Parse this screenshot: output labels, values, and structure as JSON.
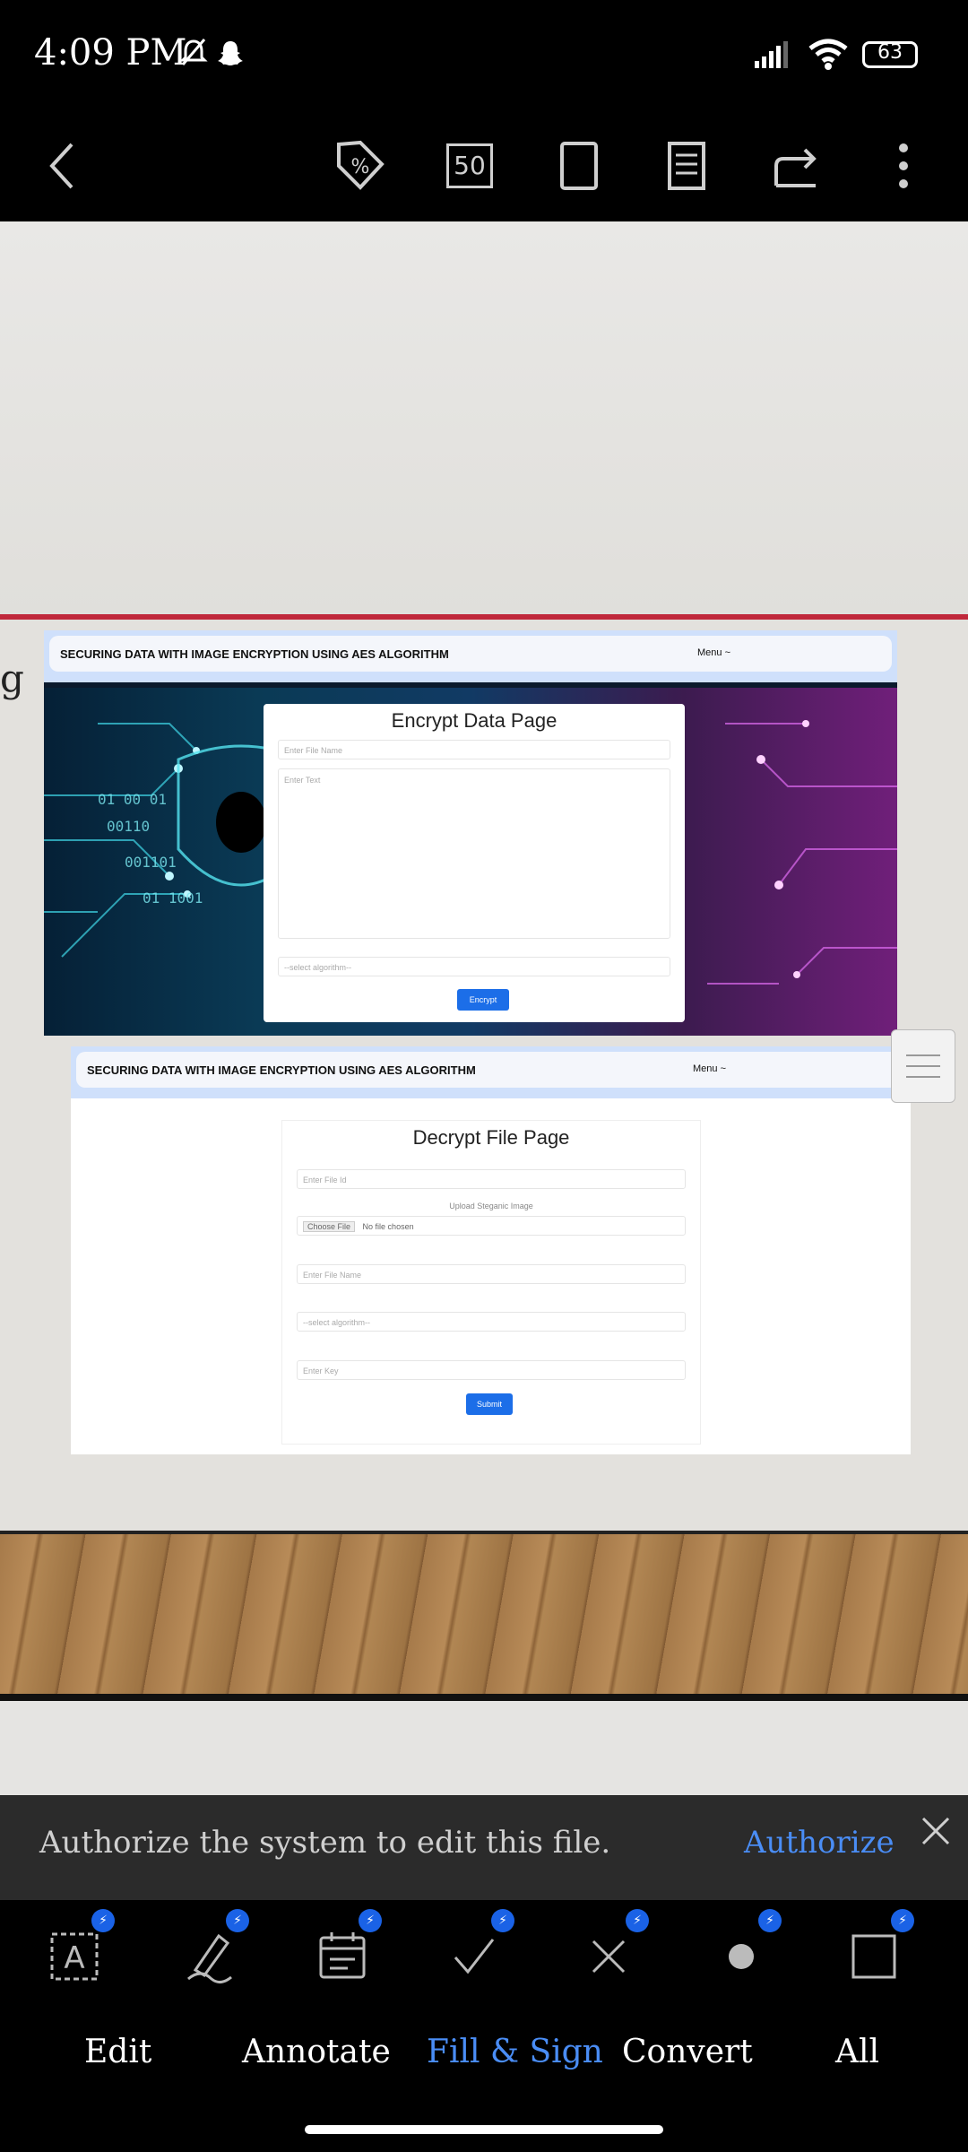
{
  "status_bar": {
    "time": "4:09 PM",
    "battery": "63"
  },
  "toolbar": {
    "page_box": "50"
  },
  "document": {
    "left_fragment": "g",
    "encrypt_page": {
      "nav_title": "SECURING DATA WITH IMAGE ENCRYPTION USING AES ALGORITHM",
      "nav_menu": "Menu ~",
      "title": "Encrypt Data Page",
      "file_name_placeholder": "Enter File Name",
      "text_placeholder": "Enter Text",
      "algorithm_select": "--select algorithm--",
      "button": "Encrypt"
    },
    "decrypt_page": {
      "nav_title": "SECURING DATA WITH IMAGE ENCRYPTION USING AES ALGORITHM",
      "nav_menu": "Menu ~",
      "title": "Decrypt File Page",
      "file_id_placeholder": "Enter File Id",
      "upload_label": "Upload Steganic Image",
      "choose_file": "Choose File",
      "no_file": "No file chosen",
      "file_name_placeholder": "Enter File Name",
      "algorithm_select": "--select algorithm--",
      "key_placeholder": "Enter Key",
      "button": "Submit"
    }
  },
  "auth_bar": {
    "message": "Authorize the system to edit this file.",
    "action": "Authorize"
  },
  "tabs": [
    {
      "label": "Edit"
    },
    {
      "label": "Annotate"
    },
    {
      "label": "Fill & Sign",
      "active": true
    },
    {
      "label": "Convert"
    },
    {
      "label": "All"
    }
  ],
  "colors": {
    "accent": "#4a8df5",
    "badge": "#1a62e6",
    "slide_rule": "#c0283b"
  }
}
